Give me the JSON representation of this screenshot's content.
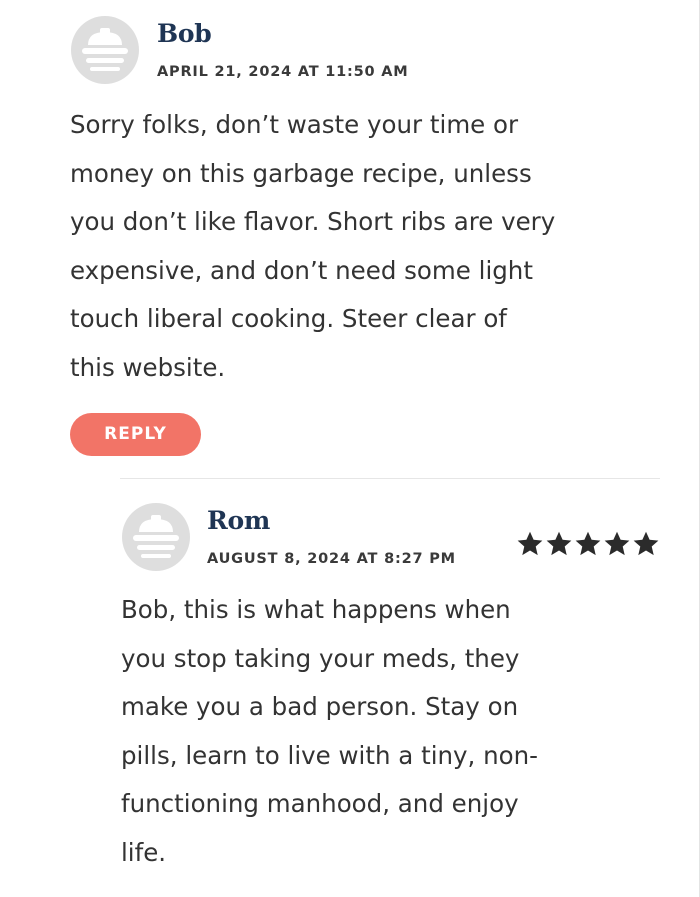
{
  "comments": [
    {
      "author": "Bob",
      "date": "APRIL 21, 2024 AT 11:50 AM",
      "text_lines": [
        "Sorry folks, don’t waste your time or",
        "money on this garbage recipe, unless",
        "you don’t like flavor. Short ribs are very",
        "expensive, and don’t need some light",
        "touch liberal cooking. Steer clear of",
        "this website."
      ],
      "reply_label": "REPLY",
      "avatar_icon": "default-avatar-icon"
    }
  ],
  "replies": [
    {
      "author": "Rom",
      "date": "AUGUST 8, 2024 AT 8:27 PM",
      "rating": 5,
      "rating_max": 5,
      "text_lines": [
        "Bob, this is what happens when",
        "you stop taking your meds, they",
        "make you a bad person. Stay on",
        "pills, learn to live with a tiny, non-",
        "functioning manhood, and enjoy",
        "life."
      ],
      "avatar_icon": "default-avatar-icon"
    }
  ],
  "colors": {
    "author": "#1f3554",
    "reply_button": "#f27467",
    "star": "#2b2b2b",
    "avatar": "#dcdcdc"
  }
}
